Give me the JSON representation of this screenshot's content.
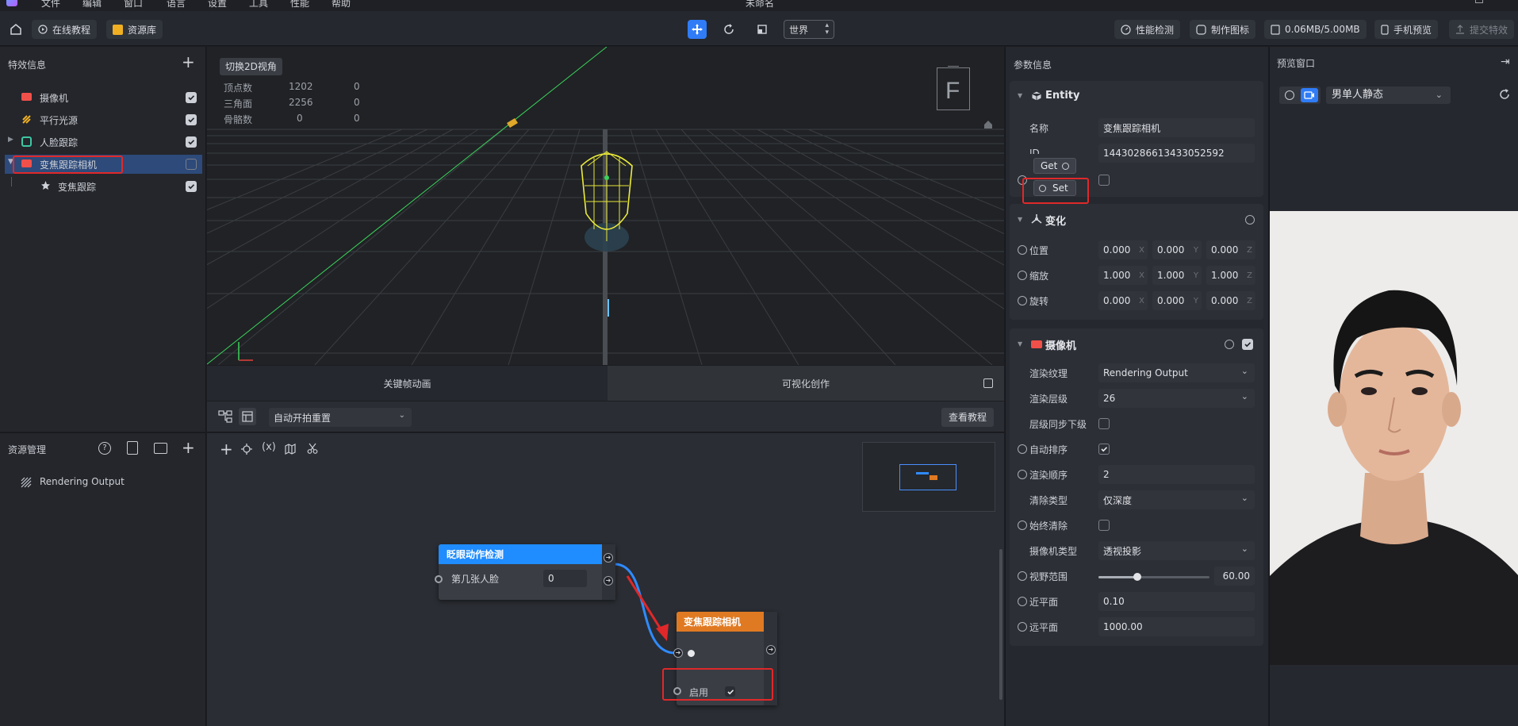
{
  "menubar": {
    "items": [
      "文件",
      "编辑",
      "窗口",
      "语言",
      "设置",
      "工具",
      "性能",
      "帮助"
    ],
    "title": "未命名"
  },
  "toolbar": {
    "tutorial_label": "在线教程",
    "assets_label": "资源库",
    "space_select": "世界",
    "perf_label": "性能检测",
    "icon_label": "制作图标",
    "size_label": "0.06MB/5.00MB",
    "phone_preview_label": "手机预览",
    "submit_label": "提交特效"
  },
  "effects_panel": {
    "title": "特效信息",
    "items": [
      {
        "label": "摄像机",
        "checked": true,
        "icon": "camera-icon"
      },
      {
        "label": "平行光源",
        "checked": true,
        "icon": "light-icon"
      },
      {
        "label": "人脸跟踪",
        "checked": true,
        "icon": "face-track-icon"
      },
      {
        "label": "变焦跟踪相机",
        "checked": false,
        "icon": "camera-icon"
      },
      {
        "label": "变焦跟踪",
        "checked": true,
        "icon": "star-icon"
      }
    ]
  },
  "assets_panel": {
    "title": "资源管理",
    "items": [
      {
        "label": "Rendering Output",
        "icon": "render-output-icon"
      }
    ]
  },
  "viewport": {
    "switch_2d_label": "切换2D视角",
    "stats": [
      {
        "label": "顶点数",
        "value": "1202",
        "value2": "0"
      },
      {
        "label": "三角面",
        "value": "2256",
        "value2": "0"
      },
      {
        "label": "骨骼数",
        "value": "0",
        "value2": "0"
      }
    ],
    "gizmo_label": "F"
  },
  "bottom_tabs": {
    "keyframe_label": "关键帧动画",
    "visual_label": "可视化创作"
  },
  "graph_toolbar": {
    "reset_select": "自动开拍重置",
    "tutorial_button": "查看教程"
  },
  "graph": {
    "node1": {
      "title": "眨眼动作检测",
      "port_label": "第几张人脸",
      "port_value": "0"
    },
    "node2": {
      "title": "变焦跟踪相机",
      "enable_label": "启用"
    }
  },
  "inspector": {
    "title": "参数信息",
    "entity": {
      "header": "Entity",
      "name_label": "名称",
      "name_value": "变焦跟踪相机",
      "id_label": "ID",
      "id_value": "14430286613433052592",
      "get_label": "Get",
      "set_label": "Set"
    },
    "transform": {
      "header": "变化",
      "rows": [
        {
          "label": "位置",
          "x": "0.000",
          "y": "0.000",
          "z": "0.000"
        },
        {
          "label": "缩放",
          "x": "1.000",
          "y": "1.000",
          "z": "1.000"
        },
        {
          "label": "旋转",
          "x": "0.000",
          "y": "0.000",
          "z": "0.000"
        }
      ],
      "axis_labels": [
        "X",
        "Y",
        "Z"
      ]
    },
    "camera": {
      "header": "摄像机",
      "render_texture_label": "渲染纹理",
      "render_texture_value": "Rendering Output",
      "render_layer_label": "渲染层级",
      "render_layer_value": "26",
      "layer_sync_label": "层级同步下级",
      "auto_sort_label": "自动排序",
      "render_order_label": "渲染顺序",
      "render_order_value": "2",
      "clear_type_label": "清除类型",
      "clear_type_value": "仅深度",
      "always_clear_label": "始终清除",
      "camera_type_label": "摄像机类型",
      "camera_type_value": "透视投影",
      "fov_label": "视野范围",
      "fov_value": "60.00",
      "fov_fraction": 0.35,
      "near_label": "近平面",
      "near_value": "0.10",
      "far_label": "远平面",
      "far_value": "1000.00"
    }
  },
  "preview": {
    "title": "预览窗口",
    "model_select": "男单人静态"
  }
}
